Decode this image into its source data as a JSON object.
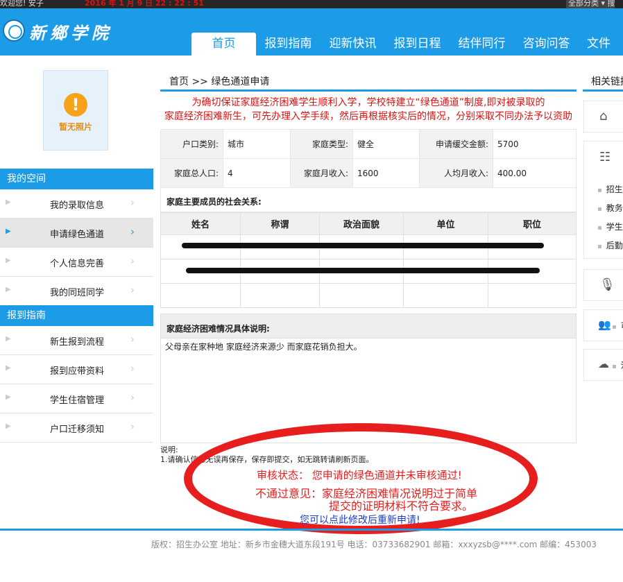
{
  "topbar": {
    "left_text": "欢迎您!  安子",
    "datetime": "2016 年 1 月 9 日   22 : 22 : 51",
    "right_text": "全部分类 ▾   搜"
  },
  "header": {
    "logo_text": "新鄉学院",
    "nav": [
      "首页",
      "报到指南",
      "迎新快讯",
      "报到日程",
      "结伴同行",
      "咨询问答",
      "文件下"
    ]
  },
  "sidebar": {
    "photo_caption": "暂无照片",
    "sections": [
      {
        "title": "我的空间",
        "items": [
          "我的录取信息",
          "申请绿色通道",
          "个人信息完善",
          "我的同班同学"
        ],
        "active": 1
      },
      {
        "title": "报到指南",
        "items": [
          "新生报到流程",
          "报到应带资料",
          "学生住宿管理",
          "户口迁移须知"
        ]
      }
    ]
  },
  "main": {
    "breadcrumb": "首页 >> 绿色通道申请",
    "notice_line1": "为确切保证家庭经济困难学生顺利入学，学校特建立“绿色通道”制度,即对被录取的",
    "notice_line2": "家庭经济困难新生，可先办理入学手续，然后再根据核实后的情况，分别采取不同办法予以资助",
    "info": {
      "hukou_label": "户口类别:",
      "hukou_value": "城市",
      "family_type_label": "家庭类型:",
      "family_type_value": "健全",
      "deferred_label": "申请缓交金额:",
      "deferred_value": "5700",
      "members_label": "家庭总人口:",
      "members_value": "4",
      "monthly_label": "家庭月收入:",
      "monthly_value": "1600",
      "per_capita_label": "人均月收入:",
      "per_capita_value": "400.00"
    },
    "relations_title": "家庭主要成员的社会关系:",
    "relations_headers": [
      "姓名",
      "称谓",
      "政治面貌",
      "单位",
      "职位"
    ],
    "difficulty_title": "家庭经济困难情况具体说明:",
    "difficulty_text": "父母亲在家种地 家庭经济来源少 而家庭花销负担大。",
    "note_title": "说明:",
    "note_text": "1.请确认信息无误再保存，保存即提交，如无跳转请刷新页面。"
  },
  "status": {
    "line1": "审核状态：  您申请的绿色通道并未审核通过!",
    "line2": "不通过意见：家庭经济困难情况说明过于简单",
    "line3": "提交的证明材料不符合要求。",
    "line4_prefix": "您可以点",
    "line4_link": "此修改",
    "line4_suffix": "后重新申请!",
    "accent": "#e61e1e"
  },
  "footer": {
    "text": "版权：招生办公室 地址：新乡市金穗大道东段191号 电话：03733682901 邮箱：xxxyzsb@****.com 邮编：453003"
  },
  "right": {
    "title": "相关链接",
    "links": [
      "招生",
      "教务",
      "学生",
      "后勤"
    ],
    "icons": [
      "home-icon",
      "sitemap-icon",
      "microphone-icon",
      "people-icon",
      "weather-icon"
    ],
    "icon_labels": [
      "可",
      "河"
    ]
  }
}
